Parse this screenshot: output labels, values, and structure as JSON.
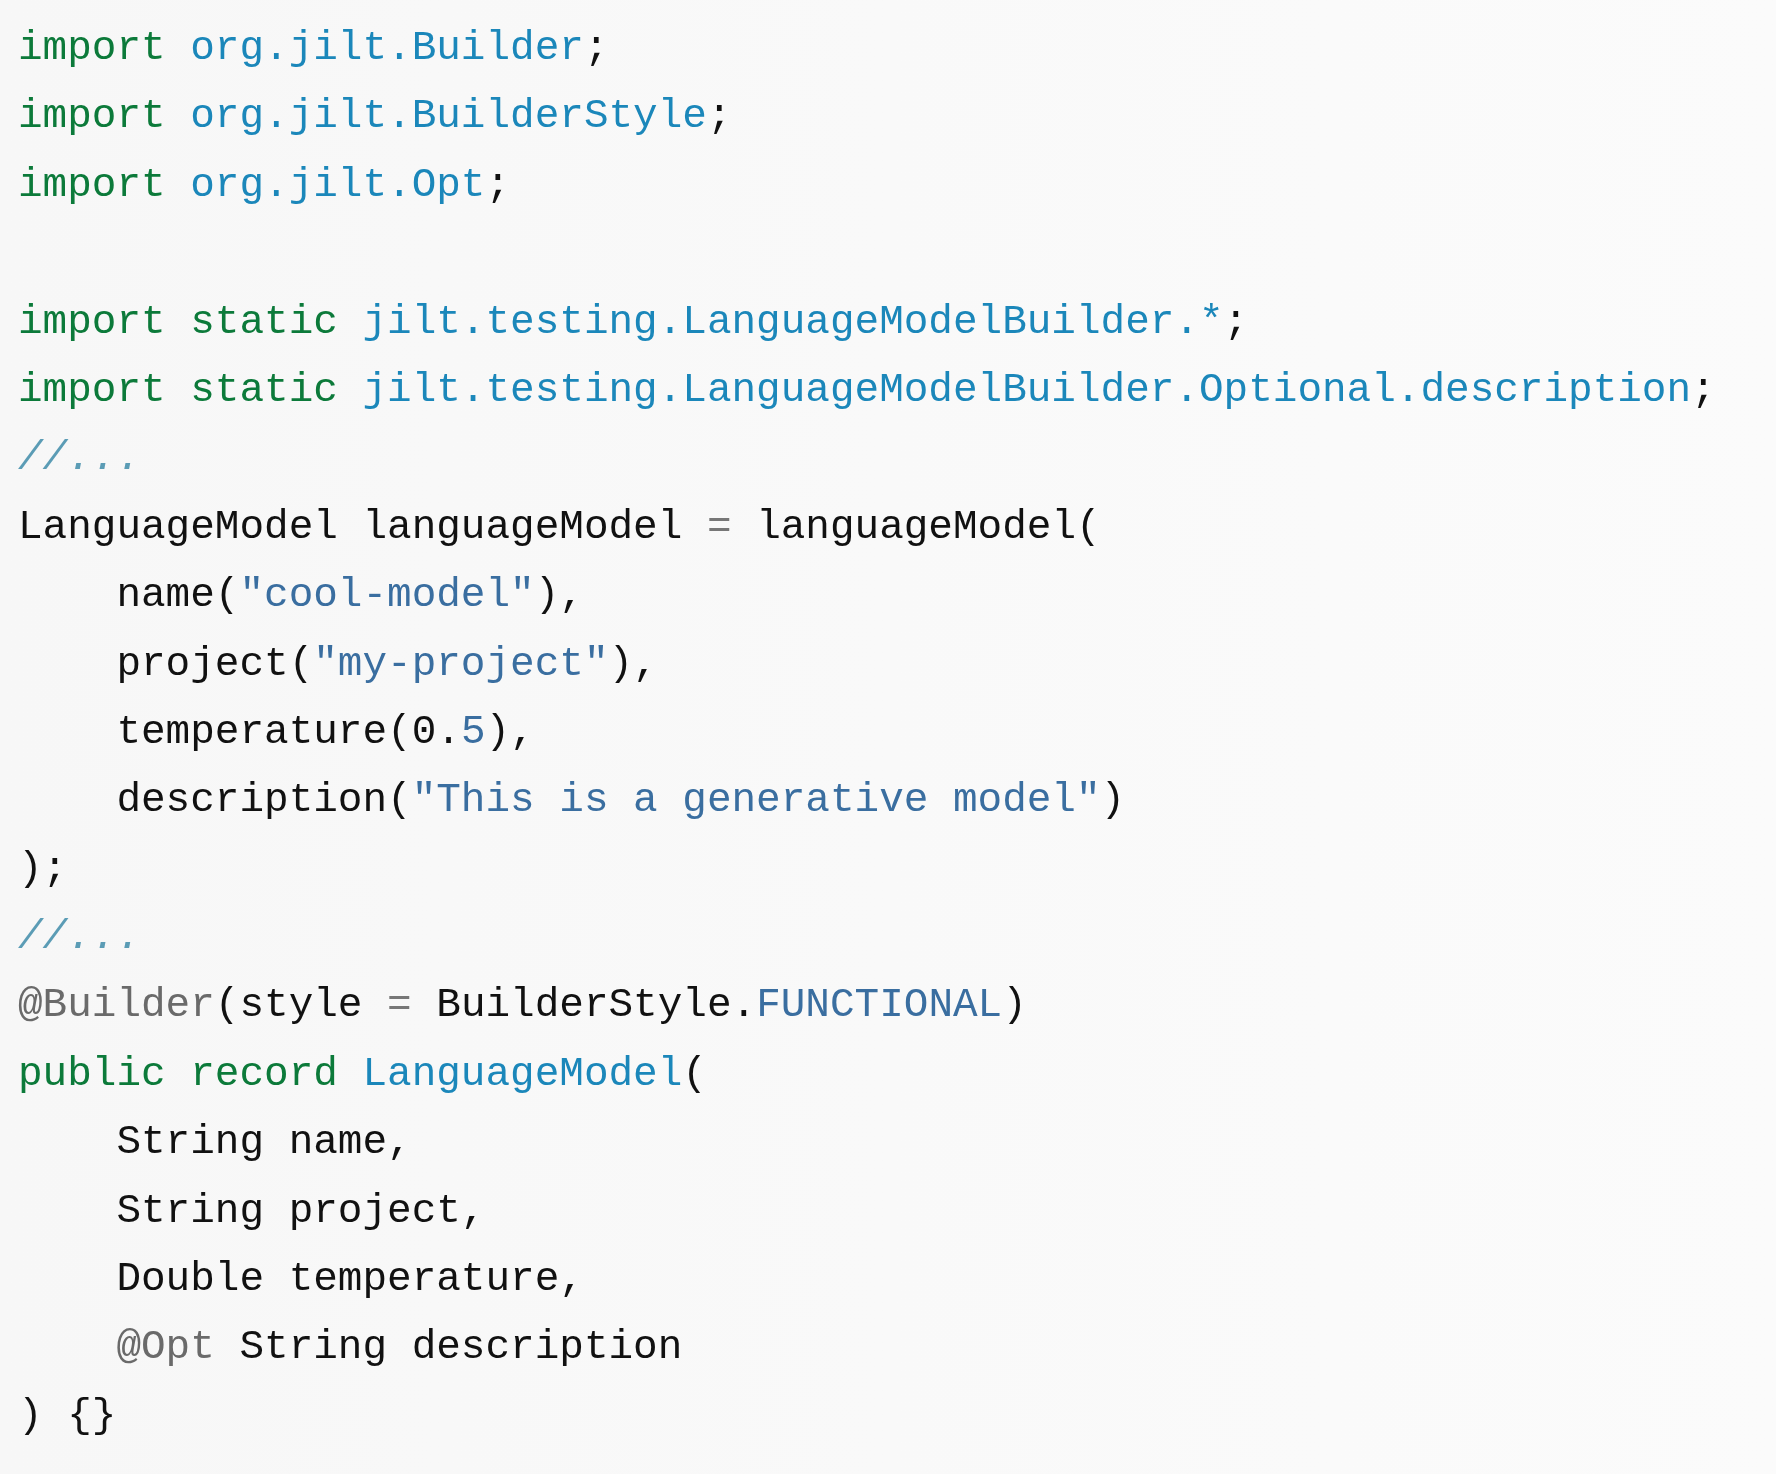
{
  "sections": [
    {
      "lines": [
        {
          "indented": false,
          "tokens": [
            {
              "kind": "keyword",
              "text": "import",
              "spaced": true
            },
            {
              "kind": "type",
              "text": "org.jilt.Builder"
            },
            {
              "kind": "plain",
              "text": ";"
            }
          ]
        },
        {
          "indented": false,
          "tokens": [
            {
              "kind": "keyword",
              "text": "import",
              "spaced": true
            },
            {
              "kind": "type",
              "text": "org.jilt.BuilderStyle"
            },
            {
              "kind": "plain",
              "text": ";"
            }
          ]
        },
        {
          "indented": false,
          "tokens": [
            {
              "kind": "keyword",
              "text": "import",
              "spaced": true
            },
            {
              "kind": "type",
              "text": "org.jilt.Opt"
            },
            {
              "kind": "plain",
              "text": ";"
            }
          ]
        }
      ]
    },
    {
      "lines": [
        {
          "indented": false,
          "tokens": [
            {
              "kind": "keyword",
              "text": "import static",
              "spaced": true
            },
            {
              "kind": "type",
              "text": "jilt.testing.LanguageModelBuilder.*"
            },
            {
              "kind": "plain",
              "text": ";"
            }
          ]
        },
        {
          "indented": false,
          "tokens": [
            {
              "kind": "keyword",
              "text": "import static",
              "spaced": true
            },
            {
              "kind": "type",
              "text": "jilt.testing.LanguageModelBuilder.Optional.description"
            },
            {
              "kind": "plain",
              "text": ";"
            }
          ]
        },
        {
          "indented": false,
          "tokens": [
            {
              "kind": "comment",
              "text": "//..."
            }
          ]
        },
        {
          "indented": false,
          "tokens": [
            {
              "kind": "plain",
              "text": "LanguageModel languageModel "
            },
            {
              "kind": "operator",
              "text": "="
            },
            {
              "kind": "plain",
              "text": " languageModel("
            }
          ]
        },
        {
          "indented": true,
          "tokens": [
            {
              "kind": "plain",
              "text": "name("
            },
            {
              "kind": "string",
              "text": "\"cool-model\""
            },
            {
              "kind": "plain",
              "text": "),"
            }
          ]
        },
        {
          "indented": true,
          "tokens": [
            {
              "kind": "plain",
              "text": "project("
            },
            {
              "kind": "string",
              "text": "\"my-project\""
            },
            {
              "kind": "plain",
              "text": "),"
            }
          ]
        },
        {
          "indented": true,
          "tokens": [
            {
              "kind": "plain",
              "text": "temperature(0."
            },
            {
              "kind": "string",
              "text": "5"
            },
            {
              "kind": "plain",
              "text": "),"
            }
          ]
        },
        {
          "indented": true,
          "tokens": [
            {
              "kind": "plain",
              "text": "description("
            },
            {
              "kind": "string",
              "text": "\"This is a generative model\""
            },
            {
              "kind": "plain",
              "text": ")"
            }
          ]
        },
        {
          "indented": false,
          "tokens": [
            {
              "kind": "plain",
              "text": ");"
            }
          ]
        },
        {
          "indented": false,
          "tokens": [
            {
              "kind": "comment",
              "text": "//..."
            }
          ]
        },
        {
          "indented": false,
          "tokens": [
            {
              "kind": "annotation",
              "text": "@Builder"
            },
            {
              "kind": "plain",
              "text": "(style "
            },
            {
              "kind": "operator",
              "text": "="
            },
            {
              "kind": "plain",
              "text": " BuilderStyle."
            },
            {
              "kind": "string",
              "text": "FUNCTIONAL"
            },
            {
              "kind": "plain",
              "text": ")"
            }
          ]
        },
        {
          "indented": false,
          "tokens": [
            {
              "kind": "keyword",
              "text": "public record",
              "spaced": true
            },
            {
              "kind": "type",
              "text": "LanguageModel"
            },
            {
              "kind": "plain",
              "text": "("
            }
          ]
        },
        {
          "indented": true,
          "tokens": [
            {
              "kind": "plain",
              "text": "String name,"
            }
          ]
        },
        {
          "indented": true,
          "tokens": [
            {
              "kind": "plain",
              "text": "String project,"
            }
          ]
        },
        {
          "indented": true,
          "tokens": [
            {
              "kind": "plain",
              "text": "Double temperature,"
            }
          ]
        },
        {
          "indented": true,
          "tokens": [
            {
              "kind": "annotation",
              "text": "@Opt"
            },
            {
              "kind": "plain",
              "text": " String description"
            }
          ]
        },
        {
          "indented": false,
          "tokens": [
            {
              "kind": "plain",
              "text": ") {}"
            }
          ]
        }
      ]
    }
  ]
}
